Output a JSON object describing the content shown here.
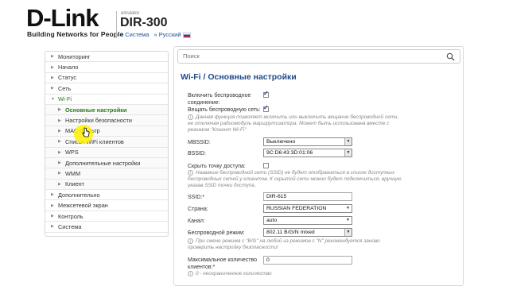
{
  "header": {
    "logo": "D-Link",
    "tagline": "Building Networks for People",
    "emulator_label": "emulator",
    "model": "DIR-300",
    "system_link": "» Система",
    "language_link": "» Русский"
  },
  "sidebar": {
    "items": [
      {
        "label": "Мониторинг"
      },
      {
        "label": "Начало"
      },
      {
        "label": "Статус"
      },
      {
        "label": "Сеть"
      },
      {
        "label": "Wi-Fi"
      },
      {
        "label": "Основные настройки"
      },
      {
        "label": "Настройки безопасности"
      },
      {
        "label": "MAC-фильтр"
      },
      {
        "label": "Список WiFi клиентов"
      },
      {
        "label": "WPS"
      },
      {
        "label": "Дополнительные настройки"
      },
      {
        "label": "WMM"
      },
      {
        "label": "Клиент"
      },
      {
        "label": "Дополнительно"
      },
      {
        "label": "Межсетевой экран"
      },
      {
        "label": "Контроль"
      },
      {
        "label": "Система"
      }
    ]
  },
  "search": {
    "placeholder": "Поиск"
  },
  "page": {
    "title": "Wi-Fi /  Основные настройки",
    "enable_wireless_label": "Включить беспроводное соединение:",
    "broadcast_label": "Вещать беспроводную сеть:",
    "broadcast_note": "Данная функция позволяет включить или выключить вещание беспроводной сети, не отключая радиомодуль маршрутизатора. Может быть использована вместе с режимом \"Клиент Wi-Fi\"",
    "mbssid_label": "MBSSID:",
    "mbssid_value": "Выключено",
    "bssid_label": "BSSID:",
    "bssid_value": "9C:D6:43:3D:01:06",
    "hide_ap_label": "Скрыть точку доступа:",
    "hide_ap_note": "Название беспроводной сети (SSID) не будет отображаться в списке доступных беспроводных сетей у клиентов. К скрытой сети можно будет подключиться, вручную указав SSID точки доступа.",
    "ssid_label": "SSID:*",
    "ssid_value": "DIR-615",
    "country_label": "Страна:",
    "country_value": "RUSSIAN FEDERATION",
    "channel_label": "Канал:",
    "channel_value": "auto",
    "mode_label": "Беспроводной режим:",
    "mode_value": "802.11 B/G/N mixed",
    "mode_note": "При смене режима с \"B/G\" на любой из режимов с \"N\" рекомендуется заново проверить настройку безопасности!",
    "max_clients_label": "Максимальное количество клиентов:*",
    "max_clients_value": "0",
    "max_clients_note": "0 - неограниченное количество"
  }
}
